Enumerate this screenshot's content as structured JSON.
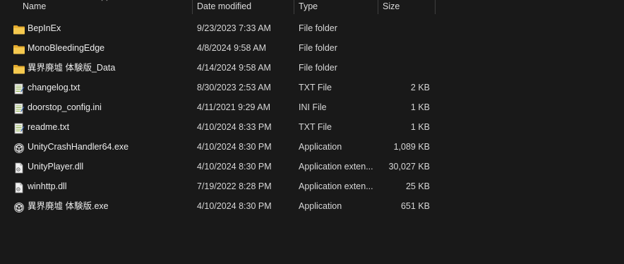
{
  "columns": {
    "name": "Name",
    "date_modified": "Date modified",
    "type": "Type",
    "size": "Size"
  },
  "files": [
    {
      "name": "BepInEx",
      "date": "9/23/2023 7:33 AM",
      "type": "File folder",
      "size": "",
      "icon": "folder-icon"
    },
    {
      "name": "MonoBleedingEdge",
      "date": "4/8/2024 9:58 AM",
      "type": "File folder",
      "size": "",
      "icon": "folder-icon"
    },
    {
      "name": "異界廃墟 体験版_Data",
      "date": "4/14/2024 9:58 AM",
      "type": "File folder",
      "size": "",
      "icon": "folder-icon"
    },
    {
      "name": "changelog.txt",
      "date": "8/30/2023 2:53 AM",
      "type": "TXT File",
      "size": "2 KB",
      "icon": "text-file-icon"
    },
    {
      "name": "doorstop_config.ini",
      "date": "4/11/2021 9:29 AM",
      "type": "INI File",
      "size": "1 KB",
      "icon": "text-file-icon"
    },
    {
      "name": "readme.txt",
      "date": "4/10/2024 8:33 PM",
      "type": "TXT File",
      "size": "1 KB",
      "icon": "text-file-icon"
    },
    {
      "name": "UnityCrashHandler64.exe",
      "date": "4/10/2024 8:30 PM",
      "type": "Application",
      "size": "1,089 KB",
      "icon": "unity-app-icon"
    },
    {
      "name": "UnityPlayer.dll",
      "date": "4/10/2024 8:30 PM",
      "type": "Application exten...",
      "size": "30,027 KB",
      "icon": "dll-file-icon"
    },
    {
      "name": "winhttp.dll",
      "date": "7/19/2022 8:28 PM",
      "type": "Application exten...",
      "size": "25 KB",
      "icon": "dll-file-icon"
    },
    {
      "name": "異界廃墟 体験版.exe",
      "date": "4/10/2024 8:30 PM",
      "type": "Application",
      "size": "651 KB",
      "icon": "unity-app-icon"
    }
  ],
  "colors": {
    "background": "#191919",
    "folder": "#f2c14e",
    "text": "#ececec"
  }
}
